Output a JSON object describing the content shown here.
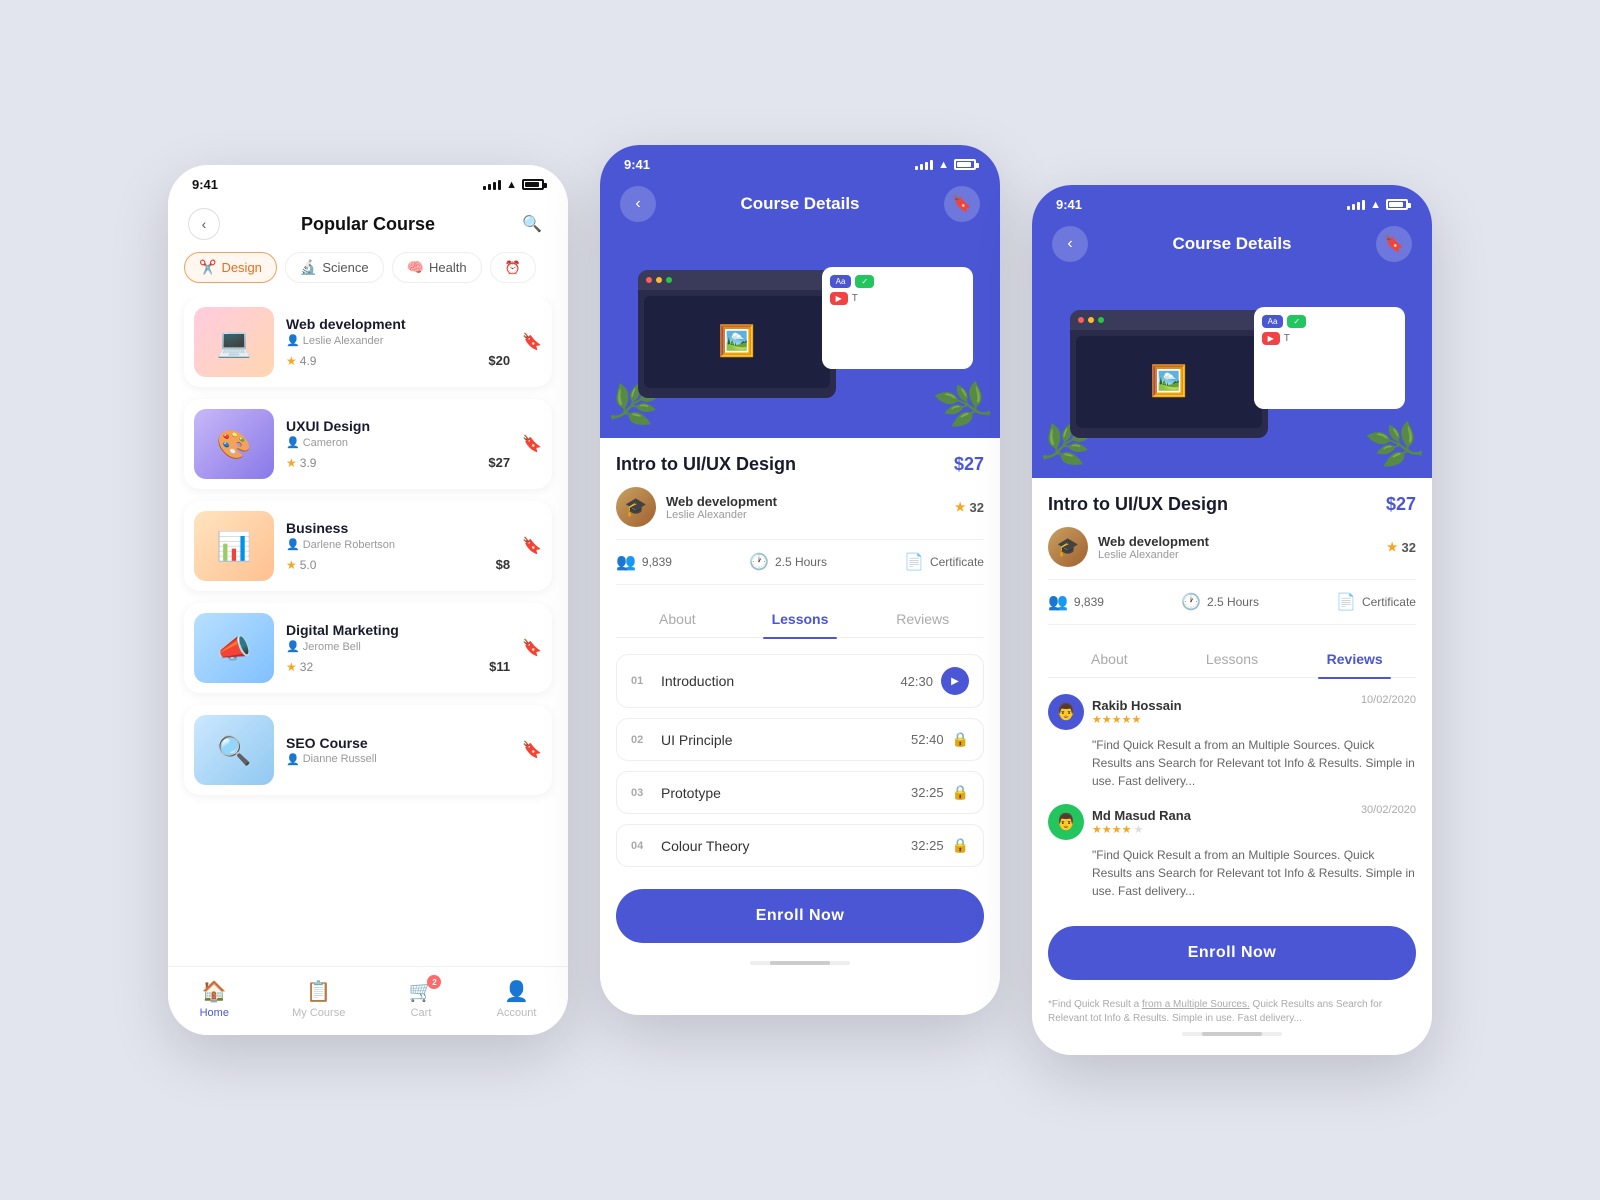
{
  "app": {
    "time": "9:41",
    "title": "Popular Course",
    "course_details_title": "Course Details"
  },
  "filters": [
    {
      "label": "Design",
      "icon": "✂️",
      "active": true
    },
    {
      "label": "Science",
      "icon": "🔬",
      "active": false
    },
    {
      "label": "Health",
      "icon": "🧠",
      "active": false
    }
  ],
  "courses": [
    {
      "name": "Web development",
      "instructor": "Leslie Alexander",
      "rating": "4.9",
      "price": "$20",
      "color": "thumb-web",
      "icon": "💻"
    },
    {
      "name": "UXUI Design",
      "instructor": "Cameron",
      "rating": "3.9",
      "price": "$27",
      "color": "thumb-ux",
      "icon": "🎨"
    },
    {
      "name": "Business",
      "instructor": "Darlene Robertson",
      "rating": "5.0",
      "price": "$8",
      "color": "thumb-biz",
      "icon": "📊"
    },
    {
      "name": "Digital Marketing",
      "instructor": "Jerome Bell",
      "rating": "32",
      "price": "$11",
      "color": "thumb-dm",
      "icon": "📣"
    },
    {
      "name": "SEO Course",
      "instructor": "Dianne Russell",
      "rating": "",
      "price": "",
      "color": "thumb-seo",
      "icon": "🔍"
    }
  ],
  "nav": [
    {
      "label": "Home",
      "icon": "🏠",
      "active": true,
      "badge": null
    },
    {
      "label": "My Course",
      "icon": "📋",
      "active": false,
      "badge": null
    },
    {
      "label": "Cart",
      "icon": "🛒",
      "active": false,
      "badge": "2"
    },
    {
      "label": "Account",
      "icon": "👤",
      "active": false,
      "badge": null
    }
  ],
  "course_detail": {
    "title": "Intro to UI/UX Design",
    "price": "$27",
    "instructor_course": "Web development",
    "instructor_name": "Leslie Alexander",
    "rating_count": "32",
    "students": "9,839",
    "duration": "2.5 Hours",
    "certificate": "Certificate",
    "tabs": [
      "About",
      "Lessons",
      "Reviews"
    ],
    "lessons_tab_active": true,
    "reviews_tab_active": false,
    "lessons": [
      {
        "num": "01",
        "title": "Introduction",
        "time": "42:30",
        "locked": false
      },
      {
        "num": "02",
        "title": "UI Principle",
        "time": "52:40",
        "locked": true
      },
      {
        "num": "03",
        "title": "Prototype",
        "time": "32:25",
        "locked": true
      },
      {
        "num": "04",
        "title": "Colour Theory",
        "time": "32:25",
        "locked": true
      }
    ],
    "reviews": [
      {
        "name": "Rakib Hossain",
        "date": "10/02/2020",
        "stars": 5,
        "text": "\"Find Quick Result a from an Multiple Sources. Quick Results ans Search for  Relevant tot Info & Results. Simple in use. Fast delivery..."
      },
      {
        "name": "Md Masud Rana",
        "date": "30/02/2020",
        "stars": 4,
        "text": "\"Find Quick Result a from an Multiple Sources. Quick Results ans Search for  Relevant tot Info & Results. Simple in use. Fast delivery..."
      }
    ],
    "enroll_label": "Enroll Now"
  }
}
